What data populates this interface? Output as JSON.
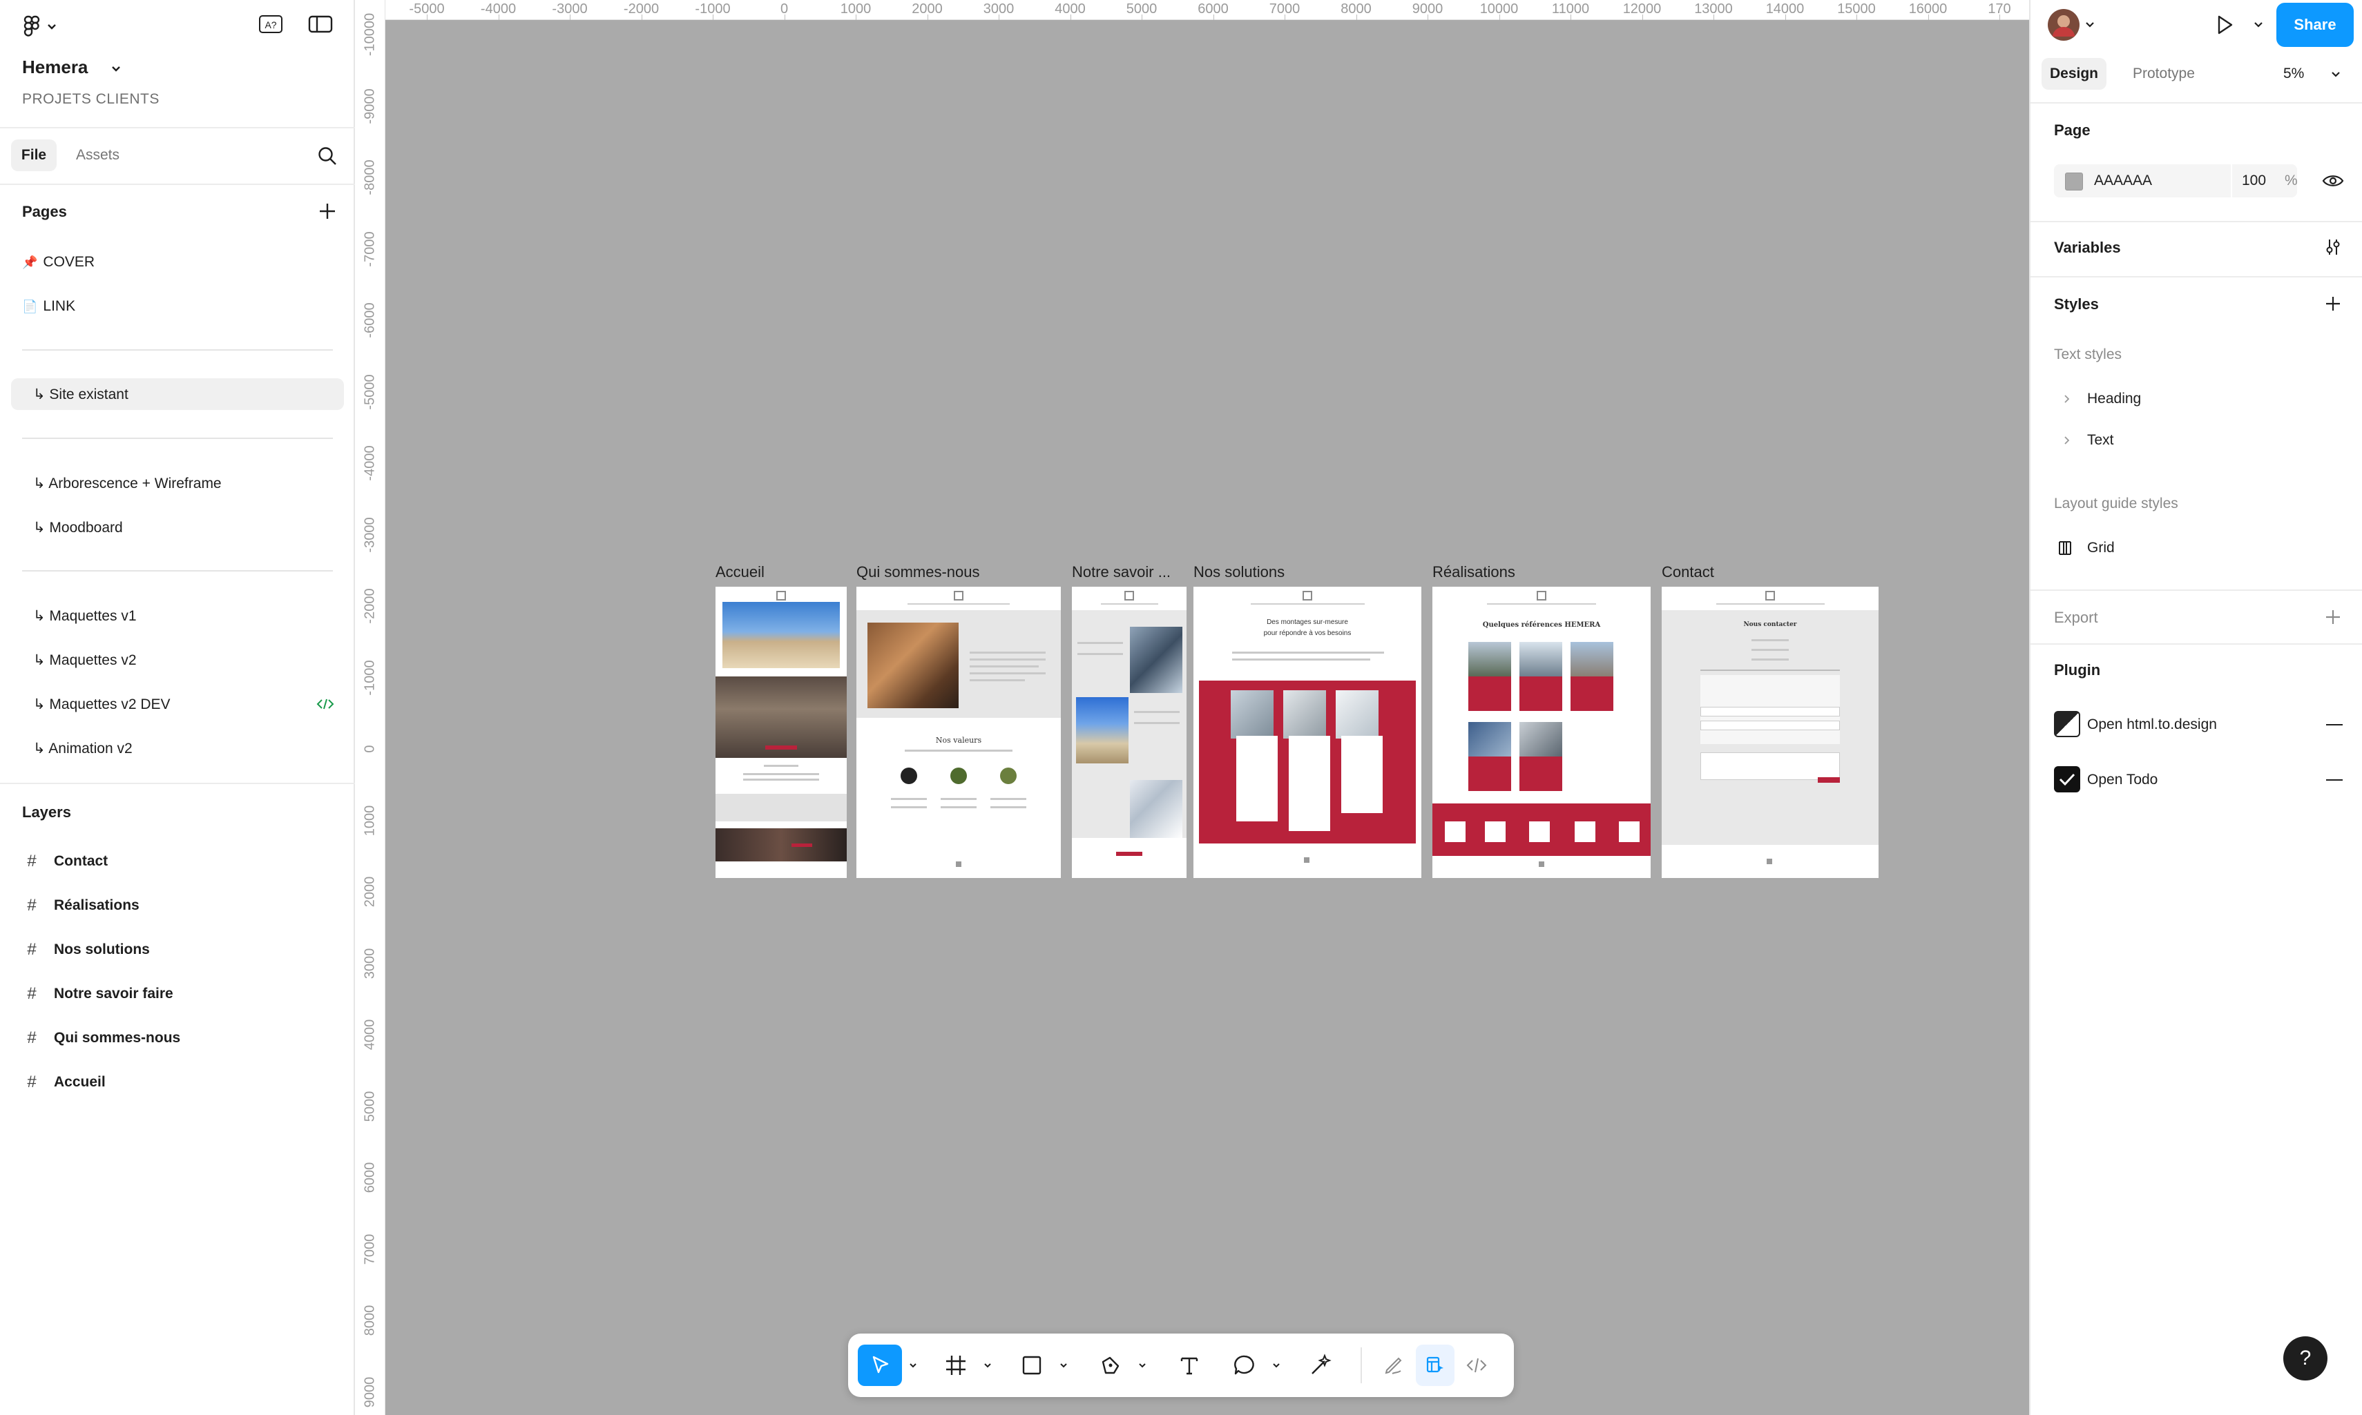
{
  "file": {
    "name": "Hemera",
    "project": "PROJETS CLIENTS",
    "tabs": {
      "file": "File",
      "assets": "Assets"
    }
  },
  "pages": {
    "title": "Pages",
    "items": [
      {
        "label": "COVER",
        "emoji": "📌"
      },
      {
        "label": "LINK",
        "emoji": "📄"
      },
      {
        "label": "↳ Site existant"
      },
      {
        "label": "↳ Arborescence + Wireframe"
      },
      {
        "label": "↳ Moodboard"
      },
      {
        "label": "↳ Maquettes v1"
      },
      {
        "label": "↳ Maquettes v2"
      },
      {
        "label": "↳ Maquettes v2 DEV"
      },
      {
        "label": "↳ Animation v2"
      }
    ]
  },
  "layers": {
    "title": "Layers",
    "items": [
      "Contact",
      "Réalisations",
      "Nos solutions",
      "Notre savoir faire",
      "Qui sommes-nous",
      "Accueil"
    ]
  },
  "ruler": {
    "top": [
      "-5000",
      "-4000",
      "-3000",
      "-2000",
      "-1000",
      "0",
      "1000",
      "2000",
      "3000",
      "4000",
      "5000",
      "6000",
      "7000",
      "8000",
      "9000",
      "10000",
      "11000",
      "12000",
      "13000",
      "14000",
      "15000",
      "16000",
      "170"
    ],
    "left": [
      "-10000",
      "-9000",
      "-8000",
      "-7000",
      "-6000",
      "-5000",
      "-4000",
      "-3000",
      "-2000",
      "-1000",
      "0",
      "1000",
      "2000",
      "3000",
      "4000",
      "5000",
      "6000",
      "7000",
      "8000",
      "9000"
    ]
  },
  "frames": {
    "accueil": "Accueil",
    "qui": "Qui sommes-nous",
    "savoir": "Notre savoir ...",
    "solutions": "Nos solutions",
    "realisations": "Réalisations",
    "contact": "Contact",
    "mock_nos_valeurs": "Nos valeurs",
    "mock_solutions_title1": "Des montages sur-mesure",
    "mock_solutions_title2": "pour répondre à vos besoins",
    "mock_realisations_title": "Quelques références HEMERA",
    "mock_contact_title": "Nous contacter"
  },
  "right": {
    "share": "Share",
    "tabs": {
      "design": "Design",
      "prototype": "Prototype"
    },
    "zoom": "5%",
    "page": {
      "title": "Page",
      "color": "AAAAAA",
      "opacity": "100",
      "unit": "%"
    },
    "variables": "Variables",
    "styles": {
      "title": "Styles",
      "text_styles": "Text styles",
      "text_items": [
        "Heading",
        "Text"
      ],
      "layout_guide": "Layout guide styles",
      "grid": "Grid"
    },
    "export": "Export",
    "plugin": {
      "title": "Plugin",
      "items": [
        "Open html.to.design",
        "Open Todo"
      ]
    }
  },
  "colors": {
    "canvas": "#aaaaaa",
    "accent": "#0d99ff",
    "brand_red": "#b8223b"
  },
  "help": "?"
}
